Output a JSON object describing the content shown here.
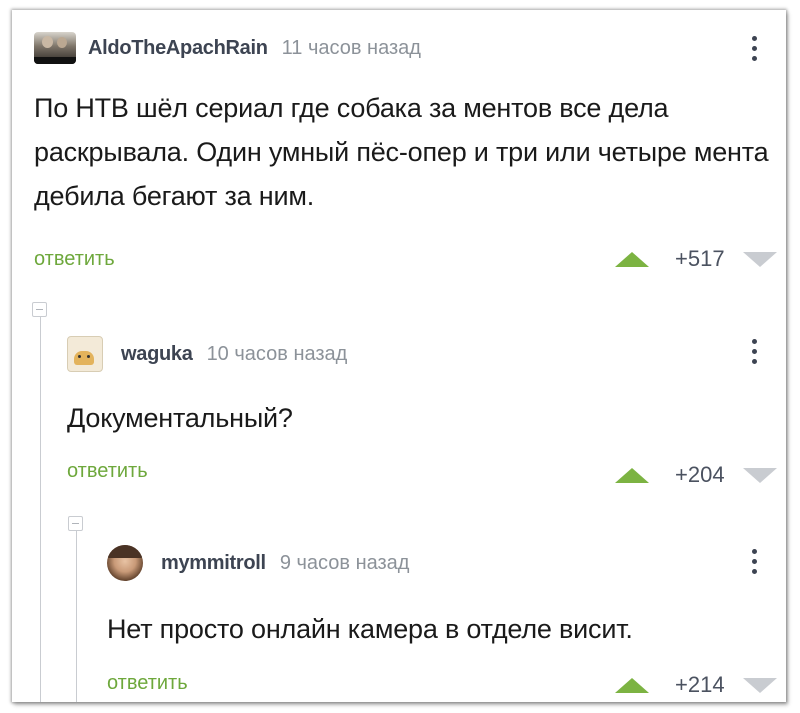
{
  "comments": [
    {
      "author": "AldoTheApachRain",
      "time": "11 часов назад",
      "text": "По НТВ шёл сериал где собака за ментов все дела раскрывала. Один умный пёс-опер и три или четыре мента дебила бегают за ним.",
      "reply_label": "ответить",
      "score": "+517",
      "avatar_icon": "avatar-photo"
    },
    {
      "author": "waguka",
      "time": "10 часов назад",
      "text": "Документальный?",
      "reply_label": "ответить",
      "score": "+204",
      "avatar_icon": "avatar-cat"
    },
    {
      "author": "mymmitroll",
      "time": "9 часов назад",
      "text": "Нет просто онлайн камера в отделе висит.",
      "reply_label": "ответить",
      "score": "+214",
      "avatar_icon": "avatar-face"
    }
  ],
  "colors": {
    "reply_green": "#6ea83c",
    "upvote_green": "#7cb342",
    "downvote_gray": "#c9ccd1",
    "author_dark": "#3d4452",
    "time_gray": "#8c9299"
  }
}
